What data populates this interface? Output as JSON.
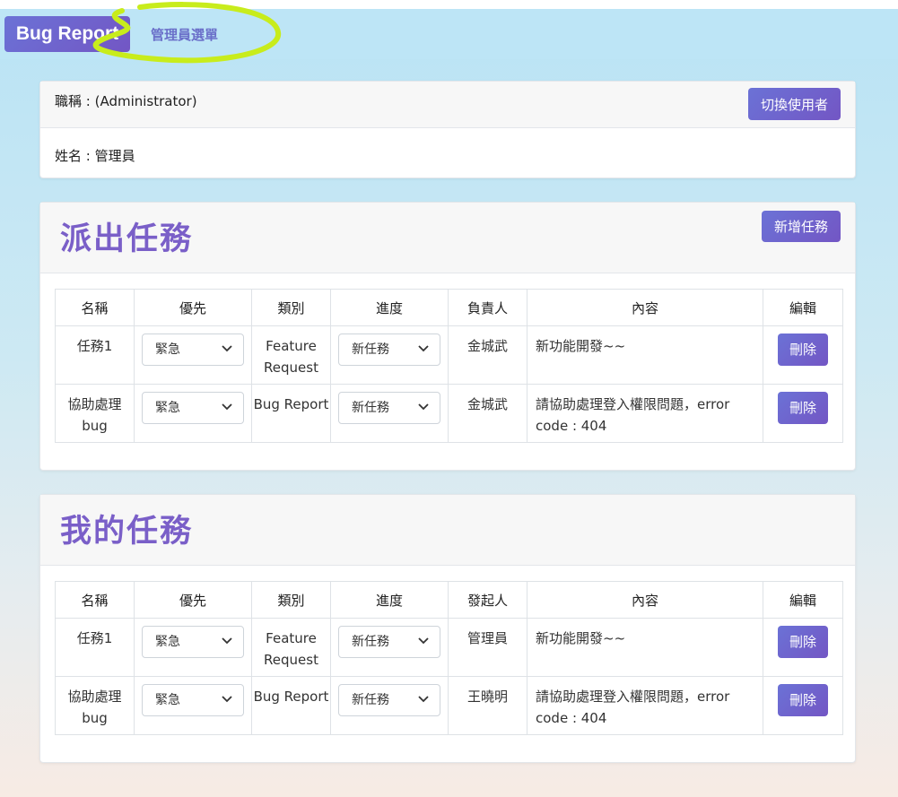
{
  "navbar": {
    "brand": "Bug Report",
    "admin_menu": "管理員選單"
  },
  "user_card": {
    "title_line": "職稱 : (Administrator)",
    "name_line": "姓名 : 管理員",
    "switch_user": "切換使用者"
  },
  "assigned_tasks": {
    "title": "派出任務",
    "add_task": "新增任務",
    "columns": [
      "名稱",
      "優先",
      "類別",
      "進度",
      "負責人",
      "內容",
      "編輯"
    ],
    "rows": [
      {
        "name": "任務1",
        "priority": "緊急",
        "category": "Feature Request",
        "progress": "新任務",
        "person": "金城武",
        "content": "新功能開發~~",
        "action": "刪除"
      },
      {
        "name": "協助處理bug",
        "priority": "緊急",
        "category": "Bug Report",
        "progress": "新任務",
        "person": "金城武",
        "content": "請協助處理登入權限問題，error code : 404",
        "action": "刪除"
      }
    ]
  },
  "my_tasks": {
    "title": "我的任務",
    "columns": [
      "名稱",
      "優先",
      "類別",
      "進度",
      "發起人",
      "內容",
      "編輯"
    ],
    "rows": [
      {
        "name": "任務1",
        "priority": "緊急",
        "category": "Feature Request",
        "progress": "新任務",
        "person": "管理員",
        "content": "新功能開發~~",
        "action": "刪除"
      },
      {
        "name": "協助處理bug",
        "priority": "緊急",
        "category": "Bug Report",
        "progress": "新任務",
        "person": "王曉明",
        "content": "請協助處理登入權限問題，error code : 404",
        "action": "刪除"
      }
    ]
  },
  "colors": {
    "accent": "#6b72d6",
    "accent_end": "#7356c4",
    "title": "#7a5fc8",
    "highlight": "#c8ec1c"
  },
  "icons": {
    "select_arrow": "chevron-down-icon"
  }
}
